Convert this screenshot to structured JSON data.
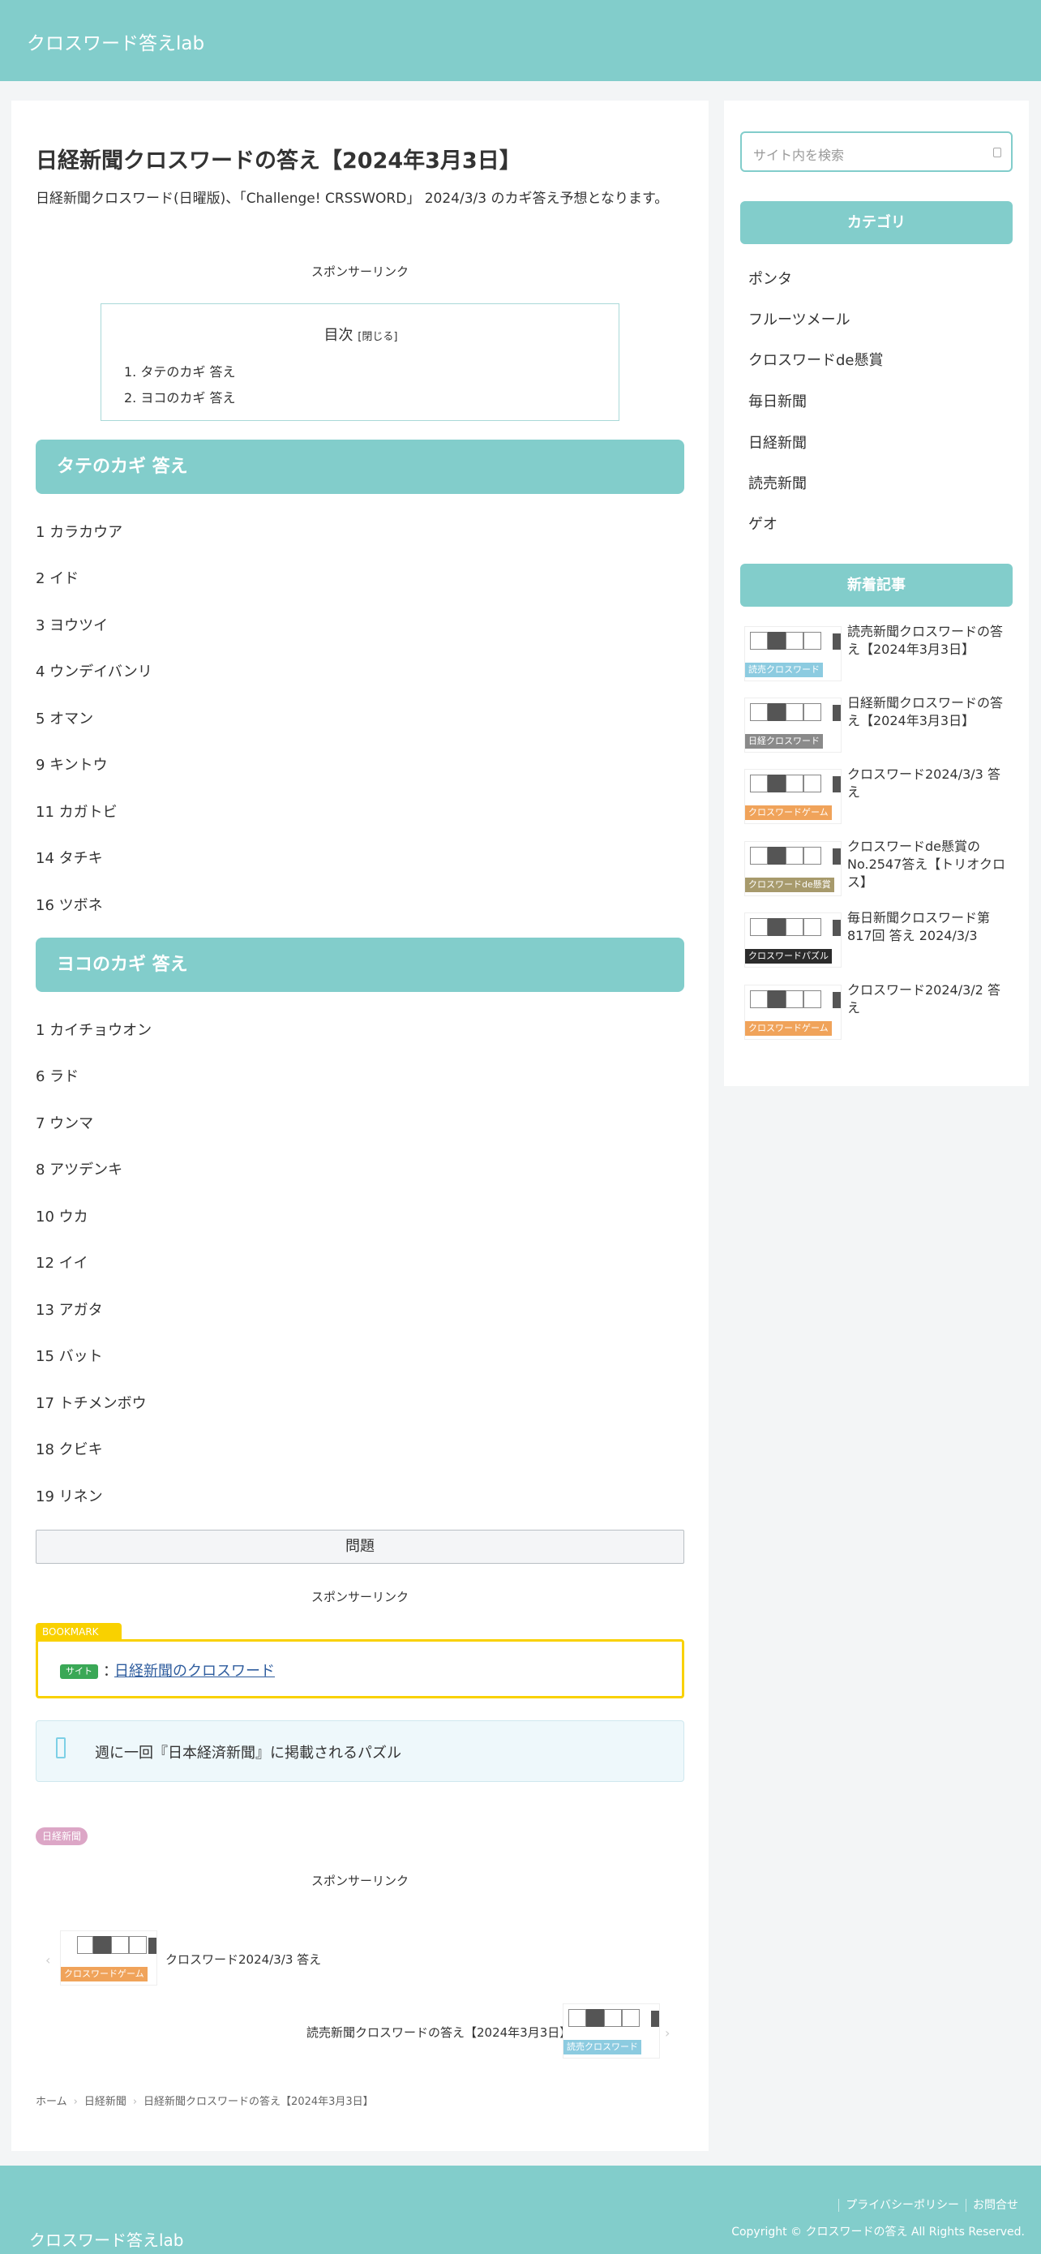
{
  "site": {
    "title": "クロスワード答えlab"
  },
  "post": {
    "title": "日経新聞クロスワードの答え【2024年3月3日】",
    "lead": "日経新聞クロスワード(日曜版)、「Challenge! CRSSWORD」 2024/3/3 のカギ答え予想となります。",
    "sponsor": "スポンサーリンク",
    "toc": {
      "title": "目次",
      "toggle": "[閉じる]",
      "items": [
        "1. タテのカギ 答え",
        "2. ヨコのカギ 答え"
      ]
    },
    "tate_heading": "タテのカギ 答え",
    "tate": [
      "1 カラカウア",
      "2 イド",
      "3 ヨウツイ",
      "4 ウンデイバンリ",
      "5 オマン",
      "9 キントウ",
      "11 カガトビ",
      "14 タチキ",
      "16 ツボネ"
    ],
    "yoko_heading": "ヨコのカギ 答え",
    "yoko": [
      "1 カイチョウオン",
      "6 ラド",
      "7 ウンマ",
      "8 アツデンキ",
      "10 ウカ",
      "12 イイ",
      "13 アガタ",
      "15 バット",
      "17 トチメンボウ",
      "18 クビキ",
      "19 リネン"
    ],
    "question_button": "問題",
    "bookmark": {
      "tag": "BOOKMARK",
      "badge": "サイト",
      "colon": "：",
      "link": "日経新聞のクロスワード"
    },
    "info": "週に一回『日本経済新聞』に掲載されるパズル",
    "category_tag": "日経新聞",
    "related": [
      {
        "text": "クロスワード2024/3/3 答え",
        "label": "クロスワードゲーム",
        "color": "#f0a35a"
      },
      {
        "text": "読売新聞クロスワードの答え【2024年3月3日】",
        "label": "読売クロスワード",
        "color": "#8ccbe0"
      }
    ],
    "breadcrumb": [
      "ホーム",
      "日経新聞",
      "日経新聞クロスワードの答え【2024年3月3日】"
    ]
  },
  "sidebar": {
    "search_placeholder": "サイト内を検索",
    "category_heading": "カテゴリ",
    "categories": [
      "ポンタ",
      "フルーツメール",
      "クロスワードde懸賞",
      "毎日新聞",
      "日経新聞",
      "読売新聞",
      "ゲオ"
    ],
    "new_heading": "新着記事",
    "new_posts": [
      {
        "text": "読売新聞クロスワードの答え【2024年3月3日】",
        "label": "読売クロスワード",
        "color": "#8ccbe0"
      },
      {
        "text": "日経新聞クロスワードの答え【2024年3月3日】",
        "label": "日経クロスワード",
        "color": "#8a8a8a"
      },
      {
        "text": "クロスワード2024/3/3 答え",
        "label": "クロスワードゲーム",
        "color": "#f0a35a"
      },
      {
        "text": "クロスワードde懸賞のNo.2547答え【トリオクロス】",
        "label": "クロスワードde懸賞",
        "color": "#a79a6c"
      },
      {
        "text": "毎日新聞クロスワード第817回 答え 2024/3/3",
        "label": "クロスワードパズル",
        "color": "#2b2b2b"
      },
      {
        "text": "クロスワード2024/3/2 答え",
        "label": "クロスワードゲーム",
        "color": "#f0a35a"
      }
    ]
  },
  "footer": {
    "links": [
      "プライバシーポリシー",
      "お問合せ"
    ],
    "copyright": "Copyright © クロスワードの答え All Rights Reserved.",
    "title": "クロスワード答えlab"
  }
}
